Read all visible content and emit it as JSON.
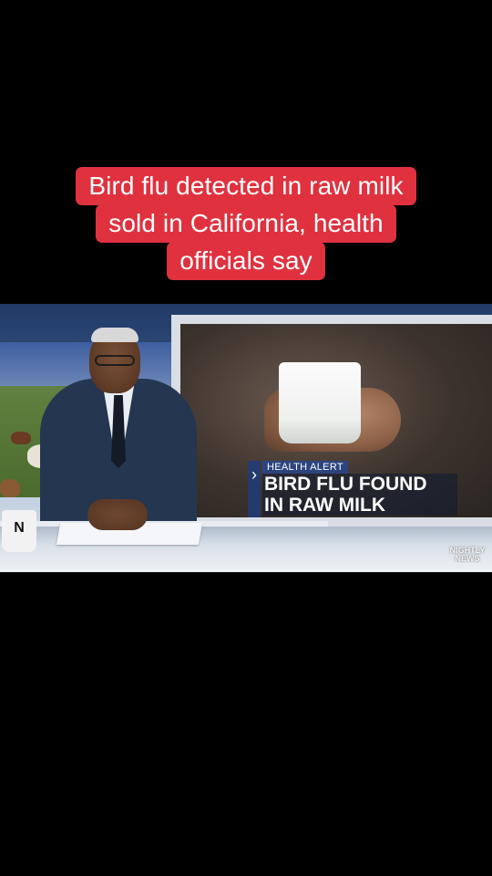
{
  "caption": {
    "lines": [
      "Bird flu detected in raw milk",
      "sold in California, health",
      "officials say"
    ]
  },
  "lower_third": {
    "arrow_glyph": "›",
    "label": "HEALTH ALERT",
    "title_lines": [
      "BIRD FLU FOUND",
      "IN RAW MILK"
    ]
  },
  "mug": {
    "logo": "N"
  },
  "watermark": {
    "lines": [
      "NIGHTLY",
      "NEWS"
    ]
  },
  "colors": {
    "caption_bg": "#e0313f",
    "background": "#000000"
  }
}
